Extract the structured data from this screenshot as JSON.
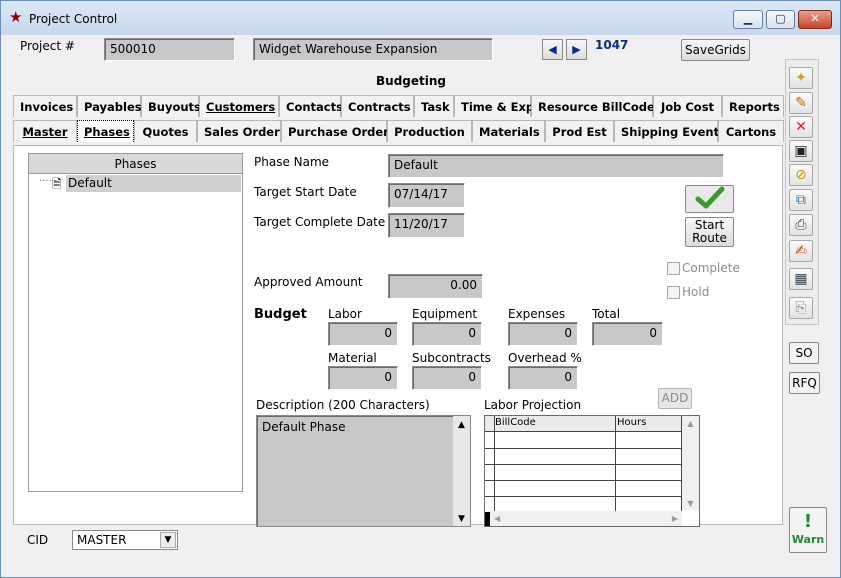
{
  "window": {
    "title": "Project Control"
  },
  "header": {
    "project_label": "Project #",
    "project_number": "500010",
    "project_name": "Widget Warehouse Expansion",
    "record_id": "1047",
    "savegrids_label": "SaveGrids",
    "prev_label": "◀",
    "next_label": "▶"
  },
  "section_title": "Budgeting",
  "tabs_row1": [
    "Invoices",
    "Payables",
    "Buyouts",
    "Customers",
    "Contacts",
    "Contracts",
    "Task",
    "Time & Exp",
    "Resource BillCodes",
    "Job Cost",
    "Reports"
  ],
  "tabs_row2": [
    "Master",
    "Phases",
    "Quotes",
    "Sales Order",
    "Purchase Order",
    "Production",
    "Materials",
    "Prod Est",
    "Shipping Events",
    "Cartons"
  ],
  "selected_tab": "Phases",
  "tree": {
    "header": "Phases",
    "items": [
      "Default"
    ]
  },
  "form": {
    "phase_name_label": "Phase Name",
    "phase_name": "Default",
    "start_label": "Target Start Date",
    "start_date": "07/14/17",
    "complete_label": "Target Complete Date",
    "complete_date": "11/20/17",
    "start_route_line1": "Start",
    "start_route_line2": "Route",
    "complete_check": "Complete",
    "hold_check": "Hold",
    "approved_label": "Approved Amount",
    "approved_amount": "0.00",
    "budget_label": "Budget",
    "labor_label": "Labor",
    "labor": "0",
    "equipment_label": "Equipment",
    "equipment": "0",
    "expenses_label": "Expenses",
    "expenses": "0",
    "total_label": "Total",
    "total": "0",
    "material_label": "Material",
    "material": "0",
    "subcontracts_label": "Subcontracts",
    "subcontracts": "0",
    "overhead_label": "Overhead %",
    "overhead": "0",
    "add_label": "ADD",
    "description_label": "Description (200 Characters)",
    "description": "Default Phase",
    "labor_projection_label": "Labor Projection",
    "grid_columns": [
      "BillCode",
      "Hours"
    ]
  },
  "footer": {
    "cid_label": "CID",
    "cid_value": "MASTER"
  },
  "side": {
    "so_label": "SO",
    "rfq_label": "RFQ",
    "warn_label": "Warn"
  },
  "colors": {
    "accent": "#0d2a8a",
    "warn": "#1e8c2e",
    "close": "#c7452a"
  }
}
